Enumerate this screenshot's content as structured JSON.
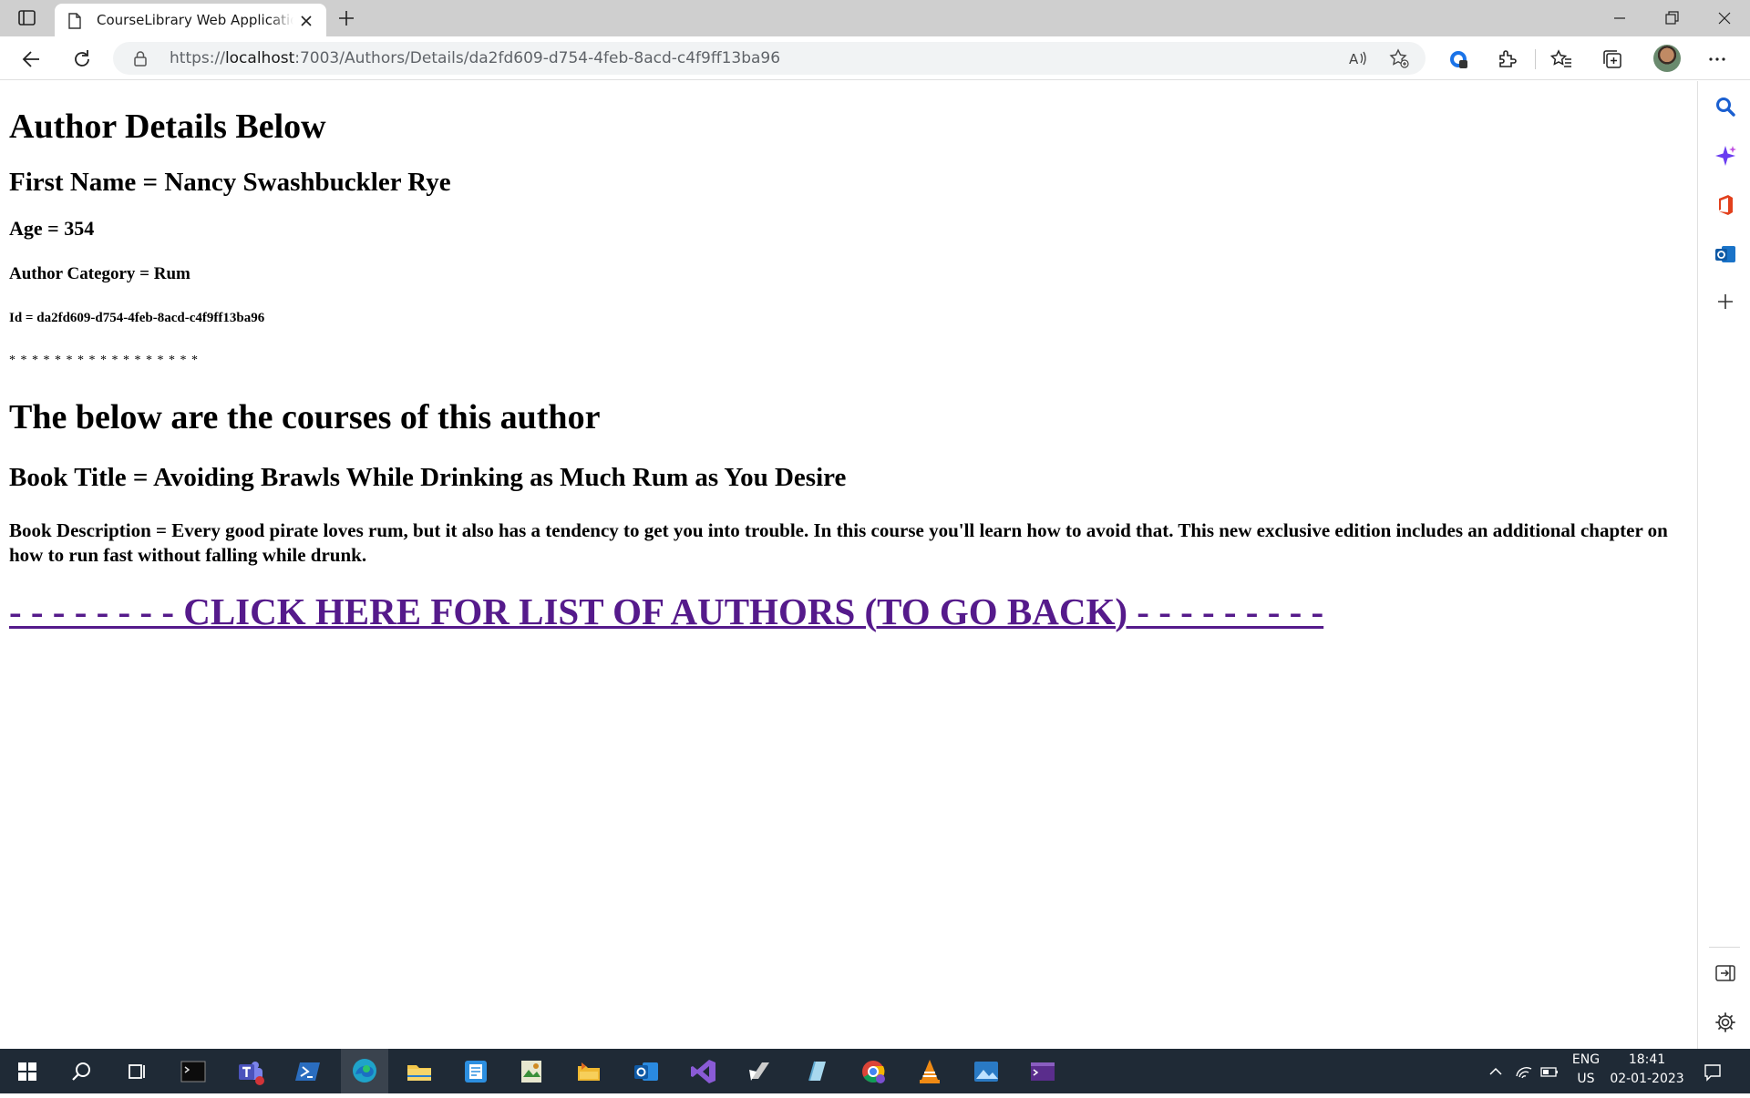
{
  "browser": {
    "tab_title": "CourseLibrary Web Application for Learning",
    "url_prefix": "https://",
    "url_host": "localhost",
    "url_rest": ":7003/Authors/Details/da2fd609-d754-4feb-8acd-c4f9ff13ba96"
  },
  "page": {
    "heading": "Author Details Below",
    "first_name": "First Name = Nancy Swashbuckler Rye",
    "age": "Age = 354",
    "category": "Author Category = Rum",
    "id": "Id = da2fd609-d754-4feb-8acd-c4f9ff13ba96",
    "separator": "* * * * * * * * * * * * * * * * *",
    "courses_heading": "The below are the courses of this author",
    "book_title": "Book Title = Avoiding Brawls While Drinking as Much Rum as You Desire",
    "book_description": "Book Description = Every good pirate loves rum, but it also has a tendency to get you into trouble. In this course you'll learn how to avoid that. This new exclusive edition includes an additional chapter on how to run fast without falling while drunk.",
    "back_link": "- - - - - - - - CLICK HERE FOR LIST OF AUTHORS (TO GO BACK) - - - - - - - - -"
  },
  "taskbar": {
    "lang": "ENG",
    "region": "US",
    "time": "18:41",
    "date": "02-01-2023"
  },
  "colors": {
    "link": "#551a8b",
    "taskbar": "#1f2a36",
    "edge_accent": "#1a73e8"
  },
  "icons": [
    "tab-actions-icon",
    "page-icon",
    "close-icon",
    "plus-icon",
    "minimize-icon",
    "restore-icon",
    "back-icon",
    "refresh-icon",
    "lock-icon",
    "read-aloud-icon",
    "add-favorite-icon",
    "tracking-icon",
    "extensions-icon",
    "favorites-icon",
    "collections-icon",
    "more-icon",
    "search-icon",
    "copilot-icon",
    "office-icon",
    "outlook-icon",
    "add-icon",
    "hide-sidebar-icon",
    "settings-icon"
  ]
}
